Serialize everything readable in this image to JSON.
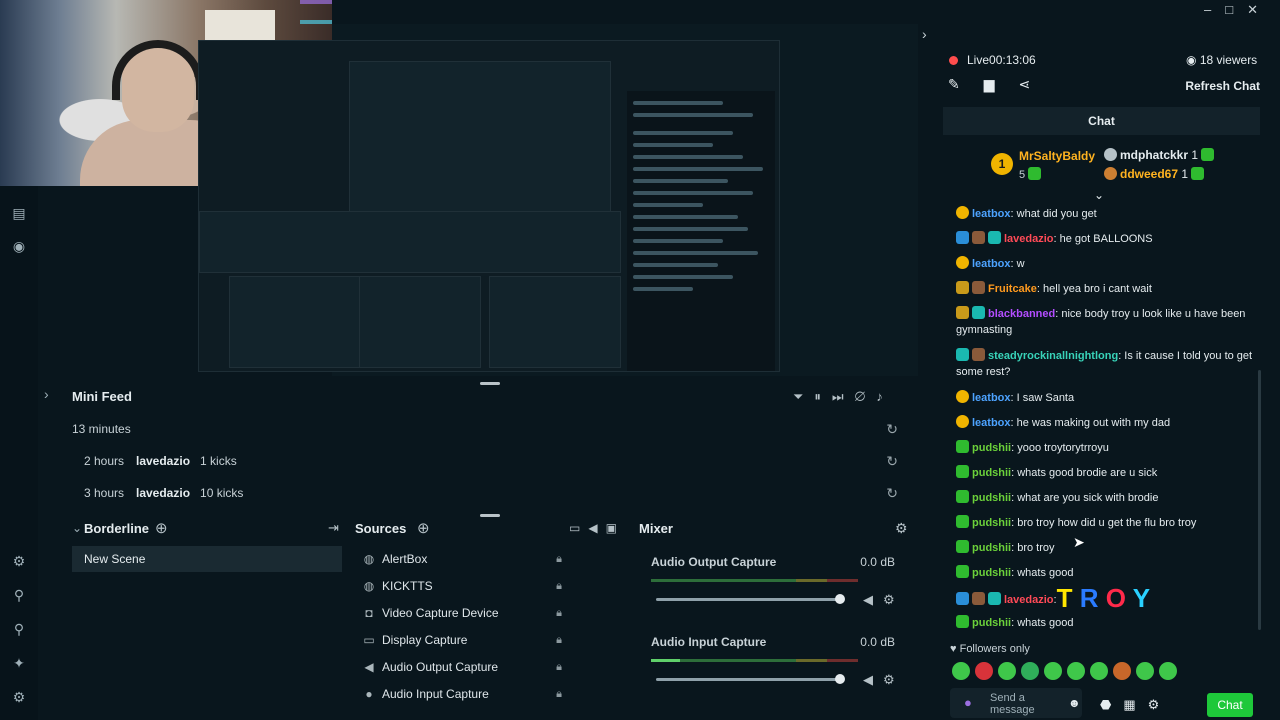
{
  "window": {
    "min_icon": "minimize-icon",
    "max_icon": "maximize-icon",
    "close_icon": "close-icon"
  },
  "stream": {
    "status": "Live",
    "time": "00:13:06",
    "viewers": "18 viewers",
    "refresh_label": "Refresh Chat",
    "chat_title": "Chat"
  },
  "leaderboard": {
    "top": {
      "rank": "1",
      "name": "MrSaltyBaldy",
      "count": "5"
    },
    "others": [
      {
        "name": "mdphatckkr",
        "count": "1"
      },
      {
        "name": "ddweed67",
        "count": "1"
      }
    ]
  },
  "chat": [
    {
      "user": "leatbox",
      "text": ": what did you get"
    },
    {
      "user": "lavedazio",
      "text": ": he got BALLOONS"
    },
    {
      "user": "leatbox",
      "text": ": w"
    },
    {
      "user": "Fruitcake",
      "text": ": hell yea bro i cant wait"
    },
    {
      "user": "blackbanned",
      "text": ": nice body troy u look like u have been gymnasting"
    },
    {
      "user": "steadyrockinallnightlong",
      "text": ": Is it cause I told you to get some rest?"
    },
    {
      "user": "leatbox",
      "text": ": I saw Santa"
    },
    {
      "user": "leatbox",
      "text": ": he was making out with my dad"
    },
    {
      "user": "pudshii",
      "text": ": yooo troytorytrroyu"
    },
    {
      "user": "pudshii",
      "text": ": whats good brodie are u sick"
    },
    {
      "user": "pudshii",
      "text": ": what are you sick with brodie"
    },
    {
      "user": "pudshii",
      "text": ": bro troy how did u get the flu bro troy"
    },
    {
      "user": "pudshii",
      "text": ": bro troy"
    },
    {
      "user": "pudshii",
      "text": ": whats good"
    },
    {
      "user": "lavedazio",
      "text": ":",
      "big": [
        "T",
        "R",
        "O",
        "Y"
      ]
    },
    {
      "user": "pudshii",
      "text": ": whats good"
    }
  ],
  "chat_footer": {
    "followers_only": "Followers only",
    "send_placeholder": "Send a message",
    "chat_button": "Chat"
  },
  "minifeed": {
    "title": "Mini Feed",
    "rows": [
      {
        "time": "13 minutes",
        "user": "",
        "event": ""
      },
      {
        "time": "2 hours",
        "user": "lavedazio",
        "event": "1 kicks"
      },
      {
        "time": "3 hours",
        "user": "lavedazio",
        "event": "10 kicks"
      }
    ]
  },
  "scenes": {
    "title": "Borderline",
    "items": [
      "New Scene"
    ]
  },
  "sources": {
    "title": "Sources",
    "items": [
      {
        "label": "AlertBox",
        "icon": "globe-icon"
      },
      {
        "label": "KICKTTS",
        "icon": "globe-icon"
      },
      {
        "label": "Video Capture Device",
        "icon": "camera-icon"
      },
      {
        "label": "Display Capture",
        "icon": "monitor-icon"
      },
      {
        "label": "Audio Output Capture",
        "icon": "speaker-icon"
      },
      {
        "label": "Audio Input Capture",
        "icon": "microphone-icon"
      }
    ]
  },
  "mixer": {
    "title": "Mixer",
    "channels": [
      {
        "name": "Audio Output Capture",
        "db": "0.0 dB",
        "level": 0.95
      },
      {
        "name": "Audio Input Capture",
        "db": "0.0 dB",
        "level": 0.95
      }
    ]
  },
  "colors": {
    "accent": "#1ec83a",
    "background": "#09161d",
    "live": "#ff4d4d"
  }
}
